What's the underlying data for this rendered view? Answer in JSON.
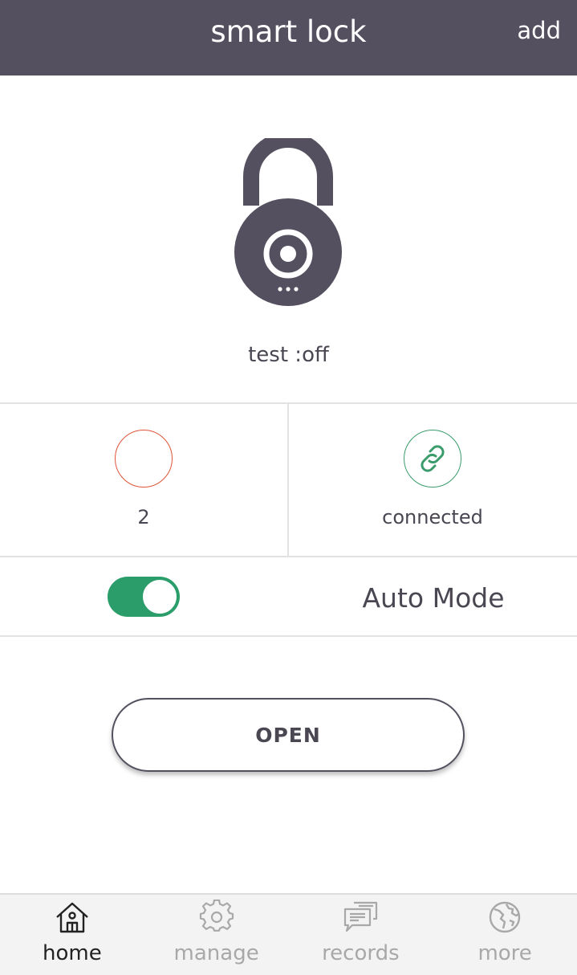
{
  "header": {
    "title": "smart lock",
    "add_label": "add"
  },
  "lock": {
    "icon": "padlock-icon",
    "status_text": "test :off"
  },
  "status": {
    "battery_value": "2",
    "connection_label": "connected"
  },
  "auto_mode": {
    "label": "Auto Mode",
    "enabled": true
  },
  "open_button": {
    "label": "OPEN"
  },
  "tabs": [
    {
      "label": "home",
      "icon": "home-icon",
      "active": true
    },
    {
      "label": "manage",
      "icon": "gear-icon",
      "active": false
    },
    {
      "label": "records",
      "icon": "chat-bubbles-icon",
      "active": false
    },
    {
      "label": "more",
      "icon": "globe-icon",
      "active": false
    }
  ],
  "colors": {
    "header_bg": "#55505f",
    "accent_green": "#2a9d6a",
    "battery_red": "#e0533a",
    "tab_active": "#222222",
    "tab_inactive": "#a8a8a8"
  }
}
